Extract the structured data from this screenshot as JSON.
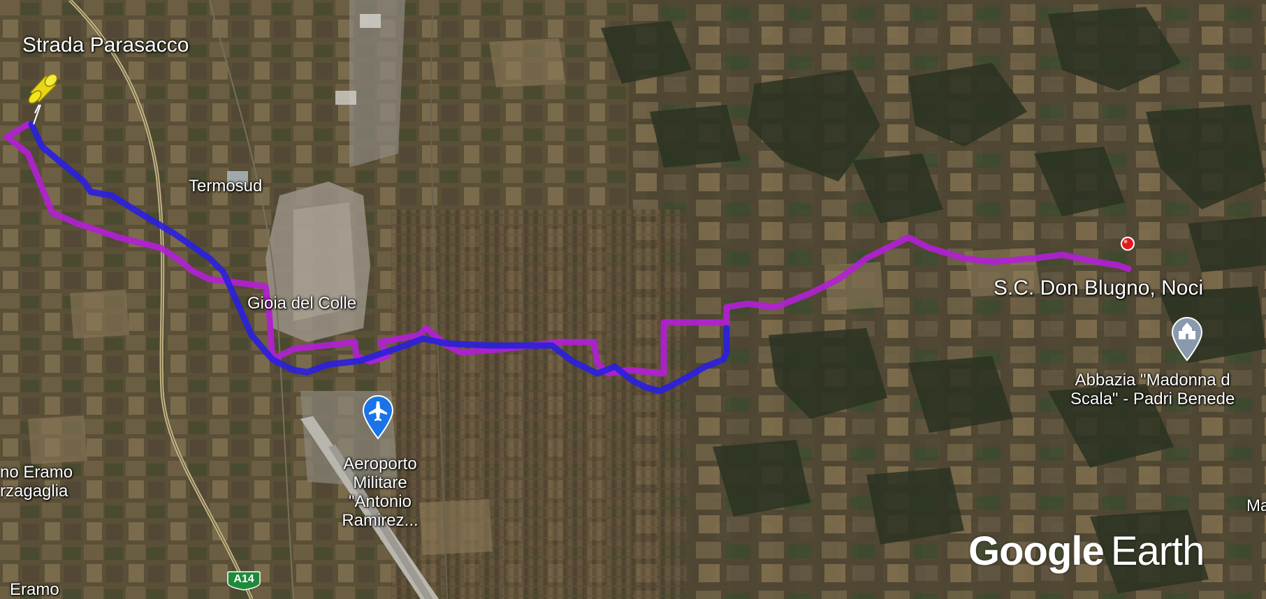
{
  "map": {
    "labels": {
      "start_point": "Strada Parasacco",
      "termosud": "Termosud",
      "town": "Gioia del Colle",
      "end_point": "S.C. Don Blugno, Noci",
      "abbey_line1": "Abbazia \"Madonna d",
      "abbey_line2": "Scala\" - Padri Benede",
      "airport_line1": "Aeroporto",
      "airport_line2": "Militare",
      "airport_line3": "\"Antonio",
      "airport_line4": "Ramirez...",
      "left_town1_line1": "no Eramo",
      "left_town1_line2": "rzagaglia",
      "left_town2": "Eramo",
      "right_edge": "Ma",
      "highway": "A14"
    },
    "watermark": {
      "google": "Google",
      "earth": "Earth"
    },
    "colors": {
      "route_outbound": "#b21fd6",
      "route_return": "#2a1fe0",
      "highway_shield": "#1e8b3a",
      "pin": "#f3e51b",
      "end_marker": "#e21a1a",
      "poi_marker": "#8a9aae",
      "airport_marker": "#1a73e8"
    },
    "icons": [
      "pushpin-icon",
      "airport-icon",
      "place-of-worship-icon",
      "end-point-dot-icon"
    ]
  }
}
